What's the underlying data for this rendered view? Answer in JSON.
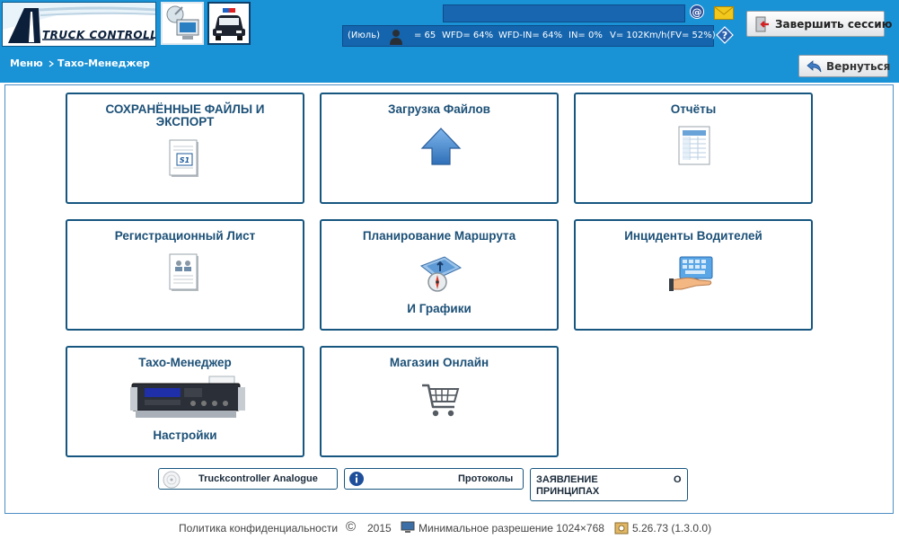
{
  "header": {
    "logo_text": "TRUCK CONTROLLER",
    "status": {
      "month": "(Июль)",
      "count": "= 65",
      "wfd": "WFD= 64%",
      "wfd_in": "WFD-IN= 64%",
      "in": "IN= 0%",
      "speed": "V= 102Km/h(FV= 52%)"
    },
    "logout_label": "Завершить сессию"
  },
  "breadcrumb": {
    "menu": "Меню",
    "current": "Тахо-Менеджер",
    "back_label": "Вернуться"
  },
  "tiles": [
    {
      "title": "СОХРАНЁННЫЕ ФАЙЛЫ И ЭКСПОРТ",
      "subtitle": "",
      "icon": "document-si-icon"
    },
    {
      "title": "Загрузка Файлов",
      "subtitle": "",
      "icon": "upload-arrow-icon"
    },
    {
      "title": "Отчёты",
      "subtitle": "",
      "icon": "spreadsheet-report-icon"
    },
    {
      "title": "Регистрационный Лист",
      "subtitle": "",
      "icon": "registration-sheet-icon"
    },
    {
      "title": "Планирование Маршрута",
      "subtitle": "И Графики",
      "icon": "route-planning-icon"
    },
    {
      "title": "Инциденты Водителей",
      "subtitle": "",
      "icon": "keyboard-hand-icon"
    },
    {
      "title": "Тахо-Менеджер",
      "subtitle": "Настройки",
      "icon": "tachograph-icon"
    },
    {
      "title": "Магазин Онлайн",
      "subtitle": "",
      "icon": "shopping-cart-icon"
    }
  ],
  "small_buttons": {
    "analogue": "Truckcontroller Analogue",
    "protocols": "Протоколы",
    "statement_a": "ЗАЯВЛЕНИЕ",
    "statement_b": "О",
    "statement_c": "ПРИНЦИПАХ"
  },
  "footer": {
    "privacy": "Политика конфиденциальности",
    "copyright_symbol": "©",
    "year": "2015",
    "resolution": "Минимальное разрешение 1024×768",
    "version": "5.26.73 (1.3.0.0)"
  },
  "colors": {
    "header_blue": "#1a92d6",
    "tile_border": "#16567f",
    "tile_text": "#1c5077"
  }
}
